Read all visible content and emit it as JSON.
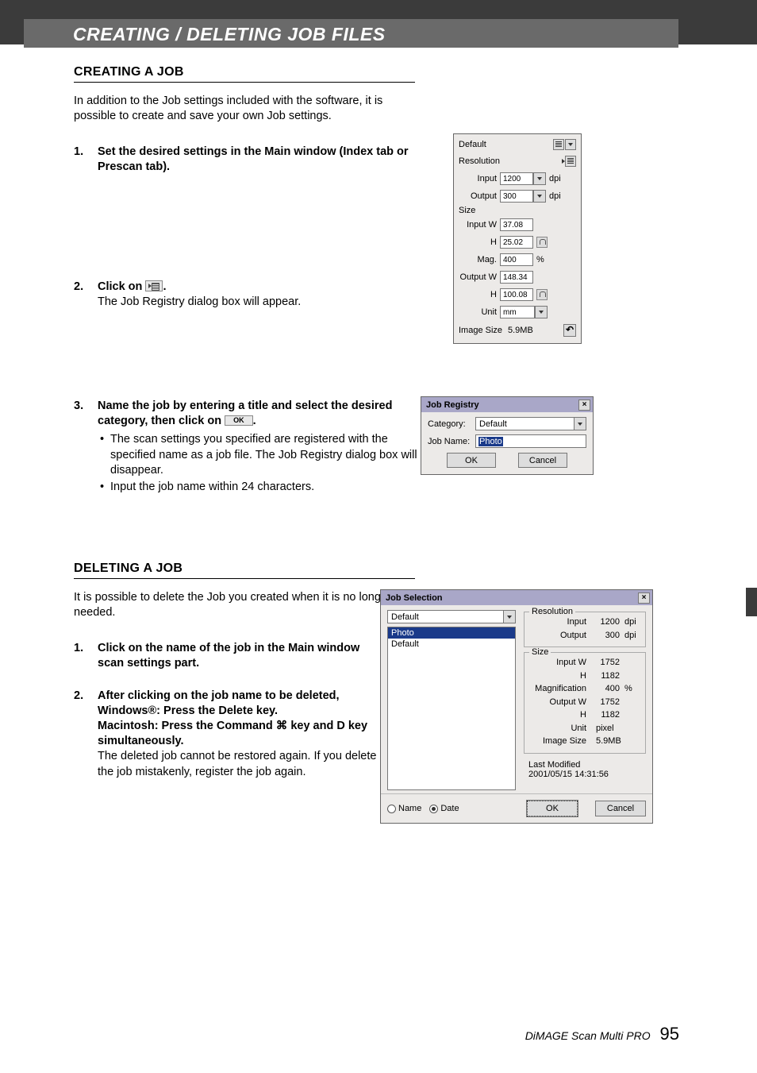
{
  "banner": "CREATING / DELETING JOB FILES",
  "creating": {
    "heading": "CREATING A JOB",
    "intro": "In addition to the Job settings included with the software, it is possible to create and save your own Job settings.",
    "step1": "Set the desired settings in the Main window (Index tab or Prescan tab).",
    "step2_a": "Click on ",
    "step2_b": ".",
    "step2_note": "The Job Registry dialog box will appear.",
    "step3_a": "Name the job by entering a title and select the desired category, then click on ",
    "step3_b": ".",
    "step3_bullet1": "The scan settings you specified are registered with the specified name as a job file. The Job Registry dialog box will disappear.",
    "step3_bullet2": "Input the job name within 24 characters."
  },
  "deleting": {
    "heading": "DELETING A JOB",
    "intro": "It is possible to delete the Job you created when it is no longer needed.",
    "step1": "Click on the name of the job in the Main window scan settings part.",
    "step2_l1": "After clicking on the job name to be deleted,",
    "step2_l2": "Windows®: Press the Delete key.",
    "step2_l3a": "Macintosh: Press the Command ",
    "step2_l3b": " key and D key simultaneously.",
    "step2_note": "The deleted job cannot be restored again. If you delete the job mistakenly, register the job again."
  },
  "main_panel": {
    "default": "Default",
    "resolution": "Resolution",
    "input_lbl": "Input",
    "input_val": "1200",
    "dpi": "dpi",
    "output_lbl": "Output",
    "output_val": "300",
    "size": "Size",
    "inw_lbl": "Input W",
    "inw_val": "37.08",
    "h_lbl": "H",
    "inh_val": "25.02",
    "mag_lbl": "Mag.",
    "mag_val": "400",
    "pct": "%",
    "outw_lbl": "Output W",
    "outw_val": "148.34",
    "outh_val": "100.08",
    "unit_lbl": "Unit",
    "unit_val": "mm",
    "imgsize_lbl": "Image Size",
    "imgsize_val": "5.9MB"
  },
  "registry": {
    "title": "Job Registry",
    "category_lbl": "Category:",
    "category_val": "Default",
    "name_lbl": "Job Name:",
    "name_val": "Photo",
    "ok": "OK",
    "cancel": "Cancel"
  },
  "selection": {
    "title": "Job Selection",
    "dropdown": "Default",
    "items": [
      "Photo",
      "Default"
    ],
    "res_legend": "Resolution",
    "res_input_lbl": "Input",
    "res_input_val": "1200",
    "dpi": "dpi",
    "res_output_lbl": "Output",
    "res_output_val": "300",
    "size_legend": "Size",
    "inw_lbl": "Input W",
    "inw_val": "1752",
    "h_lbl": "H",
    "inh_val": "1182",
    "mag_lbl": "Magnification",
    "mag_val": "400",
    "pct": "%",
    "outw_lbl": "Output W",
    "outw_val": "1752",
    "outh_val": "1182",
    "unit_lbl": "Unit",
    "unit_val": "pixel",
    "imgsize_lbl": "Image Size",
    "imgsize_val": "5.9MB",
    "lastmod_lbl": "Last Modified",
    "lastmod_val": "2001/05/15   14:31:56",
    "radio_name": "Name",
    "radio_date": "Date",
    "ok": "OK",
    "cancel": "Cancel"
  },
  "footer": {
    "product": "DiMAGE Scan Multi PRO",
    "page": "95"
  },
  "ok_inline": "OK"
}
